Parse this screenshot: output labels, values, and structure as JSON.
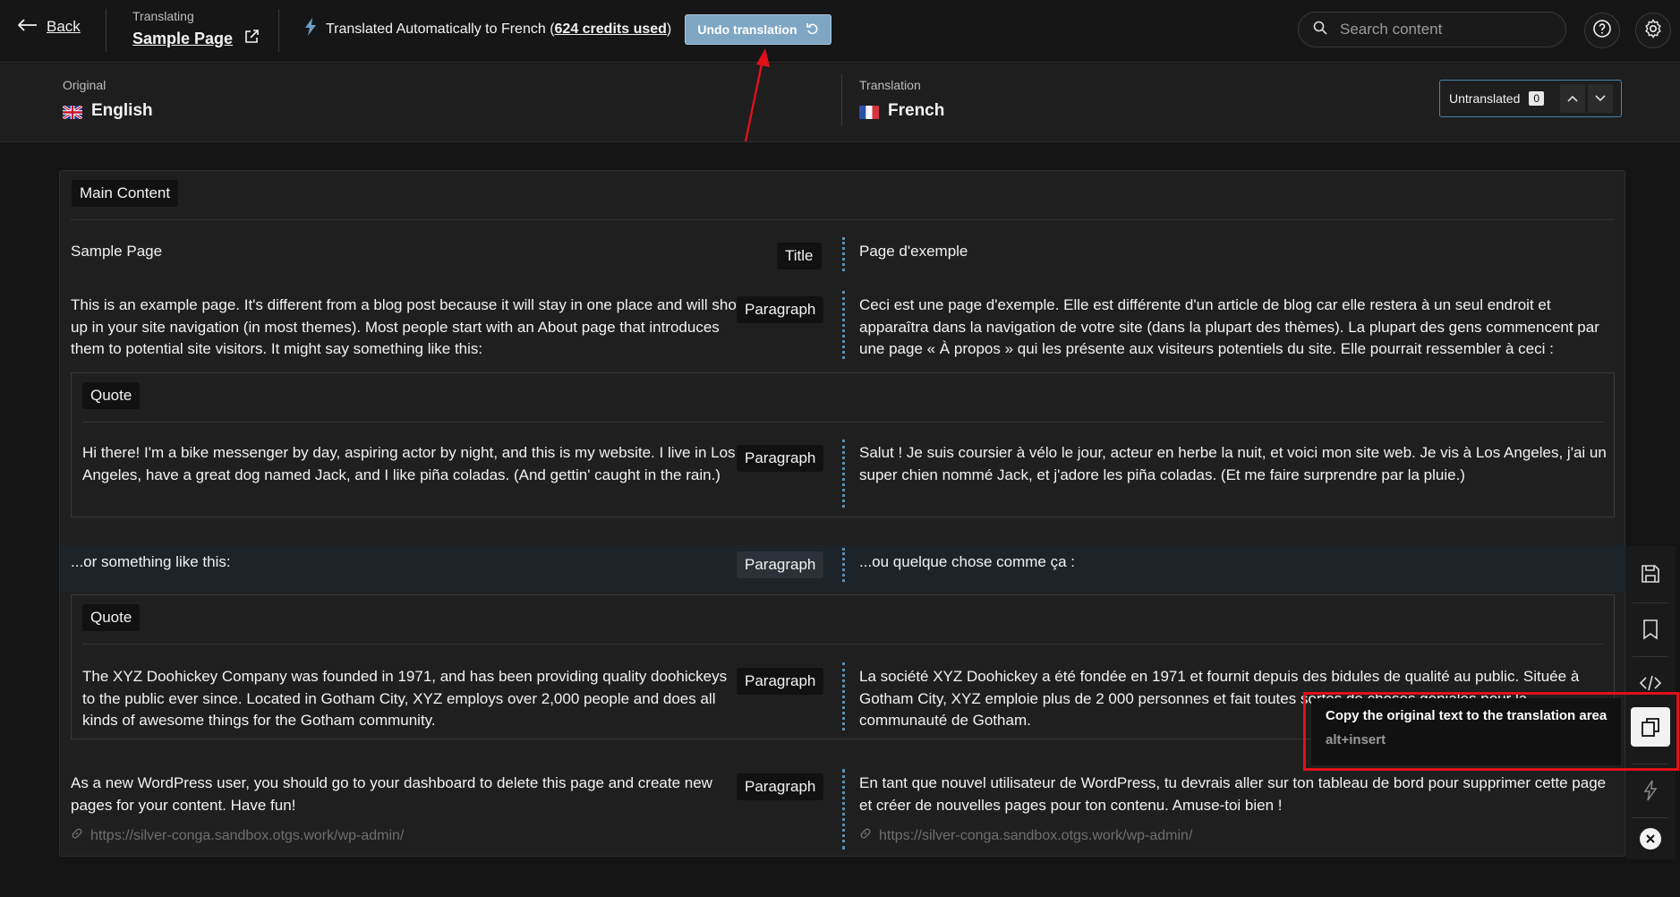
{
  "header": {
    "back_label": "Back",
    "translating_label": "Translating",
    "page_name": "Sample Page",
    "auto_prefix": "Translated Automatically to French (",
    "credits": "624 credits used",
    "auto_suffix": ")",
    "undo_label": "Undo translation",
    "search_placeholder": "Search content"
  },
  "languages": {
    "original_label": "Original",
    "original_name": "English",
    "translation_label": "Translation",
    "translation_name": "French",
    "untranslated_label": "Untranslated",
    "untranslated_count": "0"
  },
  "section_title": "Main Content",
  "rows": [
    {
      "type": "Title",
      "original": "Sample Page",
      "translation": "Page d'exemple"
    },
    {
      "type": "Paragraph",
      "original": "This is an example page. It's different from a blog post because it will stay in one place and will show up in your site navigation (in most themes). Most people start with an About page that introduces them to potential site visitors. It might say something like this:",
      "translation": "Ceci est une page d'exemple. Elle est différente d'un article de blog car elle restera à un seul endroit et apparaîtra dans la navigation de votre site (dans la plupart des thèmes). La plupart des gens commencent par une page « À propos » qui les présente aux visiteurs potentiels du site. Elle pourrait ressembler à ceci :"
    },
    {
      "type": "Paragraph",
      "group": "Quote",
      "original": "Hi there! I'm a bike messenger by day, aspiring actor by night, and this is my website. I live in Los Angeles, have a great dog named Jack, and I like piña coladas. (And gettin' caught in the rain.)",
      "translation": "Salut ! Je suis coursier à vélo le jour, acteur en herbe la nuit, et voici mon site web. Je vis à Los Angeles, j'ai un super chien nommé Jack, et j'adore les piña coladas. (Et me faire surprendre par la pluie.)"
    },
    {
      "type": "Paragraph",
      "original": "...or something like this:",
      "translation": "...ou quelque chose comme ça :"
    },
    {
      "type": "Paragraph",
      "group": "Quote",
      "original": "The XYZ Doohickey Company was founded in 1971, and has been providing quality doohickeys to the public ever since. Located in Gotham City, XYZ employs over 2,000 people and does all kinds of awesome things for the Gotham community.",
      "translation": "La société XYZ Doohickey a été fondée en 1971 et fournit depuis des bidules de qualité au public. Située à Gotham City, XYZ emploie plus de 2 000 personnes et fait toutes sortes de choses géniales pour la communauté de Gotham."
    },
    {
      "type": "Paragraph",
      "original": "As a new WordPress user, you should go to your dashboard to delete this page and create new pages for your content. Have fun!",
      "translation": "En tant que nouvel utilisateur de WordPress, tu devrais aller sur ton tableau de bord pour supprimer cette page et créer de nouvelles pages pour ton contenu. Amuse-toi bien !"
    }
  ],
  "link_url": "https://silver-conga.sandbox.otgs.work/wp-admin/",
  "tooltip": {
    "title": "Copy the original text to the translation area",
    "shortcut": "alt+insert"
  },
  "colors": {
    "accent": "#7fa7c4",
    "highlight_box": "#e0101a",
    "annotation_arrow": "#e0101a"
  },
  "icons": [
    "arrow-left-icon",
    "external-link-icon",
    "lightning-icon",
    "undo-icon",
    "search-icon",
    "help-icon",
    "gear-icon",
    "uk-flag-icon",
    "france-flag-icon",
    "chevron-up-icon",
    "chevron-down-icon",
    "save-icon",
    "bookmark-icon",
    "code-icon",
    "copy-icon",
    "close-icon",
    "link-icon"
  ]
}
